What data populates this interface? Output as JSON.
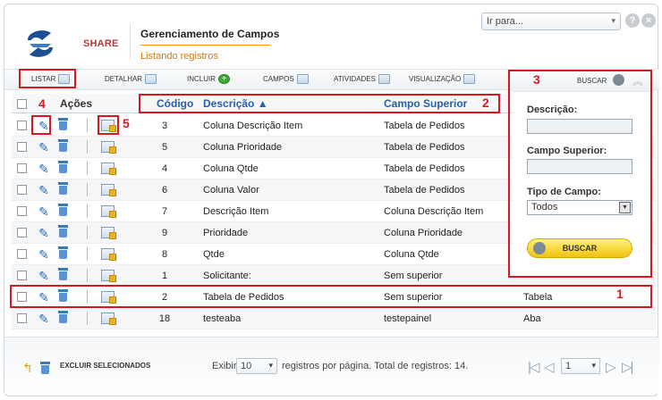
{
  "header": {
    "brand": "SHARE",
    "title": "Gerenciamento de Campos",
    "subtitle": "Listando registros",
    "goto_value": "Ir para...",
    "goto_arrow": "▾",
    "help_icon": "?",
    "close_icon": "×"
  },
  "toolbar": {
    "items": [
      "LISTAR",
      "DETALHAR",
      "INCLUIR",
      "CAMPOS",
      "ATIVIDADES",
      "VISUALIZAÇÃO"
    ],
    "search_label": "BUSCAR"
  },
  "table": {
    "headers": {
      "actions": "Ações",
      "code": "Código",
      "description": "Descrição ▲",
      "parent": "Campo Superior"
    },
    "rows": [
      {
        "code": "3",
        "description": "Coluna Descrição Item",
        "parent": "Tabela de Pedidos",
        "type": ""
      },
      {
        "code": "5",
        "description": "Coluna Prioridade",
        "parent": "Tabela de Pedidos",
        "type": ""
      },
      {
        "code": "4",
        "description": "Coluna Qtde",
        "parent": "Tabela de Pedidos",
        "type": ""
      },
      {
        "code": "6",
        "description": "Coluna Valor",
        "parent": "Tabela de Pedidos",
        "type": ""
      },
      {
        "code": "7",
        "description": "Descrição Item",
        "parent": "Coluna Descrição Item",
        "type": ""
      },
      {
        "code": "9",
        "description": "Prioridade",
        "parent": "Coluna Prioridade",
        "type": ""
      },
      {
        "code": "8",
        "description": "Qtde",
        "parent": "Coluna Qtde",
        "type": ""
      },
      {
        "code": "1",
        "description": "Solicitante:",
        "parent": "Sem superior",
        "type": ""
      },
      {
        "code": "2",
        "description": "Tabela de Pedidos",
        "parent": "Sem superior",
        "type": "Tabela"
      },
      {
        "code": "18",
        "description": "testeaba",
        "parent": "testepainel",
        "type": "Aba"
      }
    ]
  },
  "search_panel": {
    "description_label": "Descrição:",
    "parent_label": "Campo Superior:",
    "type_label": "Tipo de Campo:",
    "type_value": "Todos",
    "button_label": "BUSCAR"
  },
  "footer": {
    "delete_selected": "EXCLUIR SELECIONADOS",
    "show_label": "Exibir",
    "per_page": "10",
    "records_text": "registros por página. Total de registros: 14.",
    "page": "1"
  },
  "annotations": [
    "1",
    "2",
    "3",
    "4",
    "5"
  ]
}
